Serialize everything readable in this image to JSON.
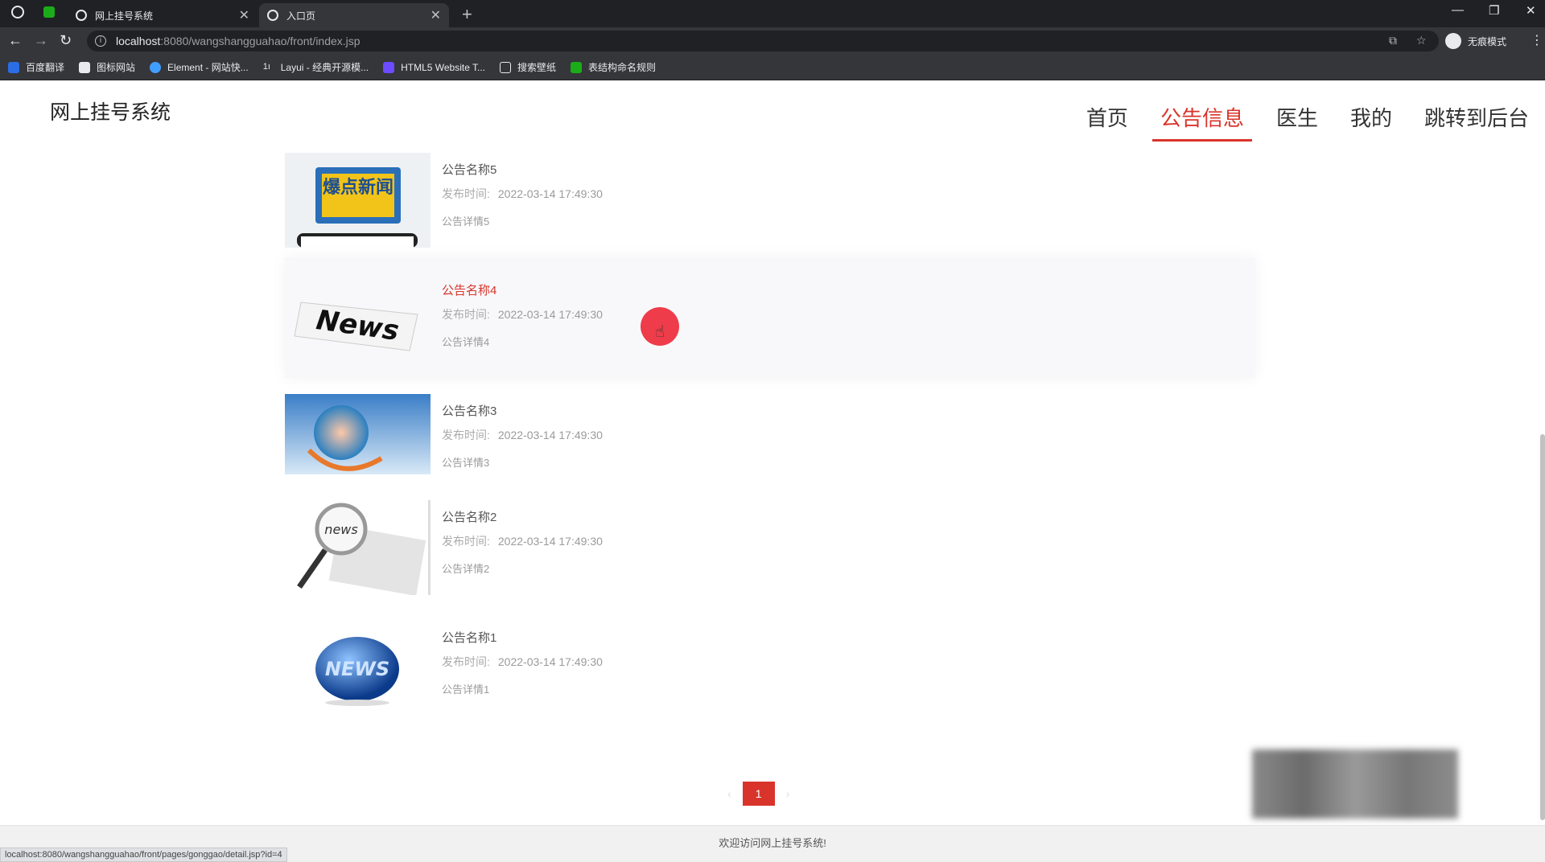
{
  "browser": {
    "tabs": [
      {
        "title": "网上挂号系统",
        "active": false
      },
      {
        "title": "入口页",
        "active": true
      }
    ],
    "new_tab": "+",
    "address": {
      "host": "localhost",
      "path": ":8080/wangshangguahao/front/index.jsp"
    },
    "profile_label": "无痕模式",
    "bookmarks": [
      {
        "label": "百度翻译",
        "color": "#2b6de5"
      },
      {
        "label": "图标网站",
        "color": "#e8eaed"
      },
      {
        "label": "Element - 网站快...",
        "color": "#409eff"
      },
      {
        "label": "Layui - 经典开源模...",
        "color": "#e8eaed"
      },
      {
        "label": "HTML5 Website T...",
        "color": "#6d4cff"
      },
      {
        "label": "搜索壁纸",
        "color": "#e8eaed"
      },
      {
        "label": "表结构命名规则",
        "color": "#1aad19"
      }
    ]
  },
  "site": {
    "title": "网上挂号系统"
  },
  "nav": {
    "items": [
      {
        "label": "首页",
        "active": false
      },
      {
        "label": "公告信息",
        "active": true
      },
      {
        "label": "医生",
        "active": false
      },
      {
        "label": "我的",
        "active": false
      },
      {
        "label": "跳转到后台",
        "active": false
      }
    ]
  },
  "news": [
    {
      "title": "公告名称5",
      "time_label": "发布时间:",
      "time": "2022-03-14 17:49:30",
      "detail": "公告详情5",
      "image": "爆点新闻",
      "hover": false
    },
    {
      "title": "公告名称4",
      "time_label": "发布时间:",
      "time": "2022-03-14 17:49:30",
      "detail": "公告详情4",
      "image": "News",
      "hover": true
    },
    {
      "title": "公告名称3",
      "time_label": "发布时间:",
      "time": "2022-03-14 17:49:30",
      "detail": "公告详情3",
      "image": "globe-blue",
      "hover": false
    },
    {
      "title": "公告名称2",
      "time_label": "发布时间:",
      "time": "2022-03-14 17:49:30",
      "detail": "公告详情2",
      "image": "news",
      "hover": false
    },
    {
      "title": "公告名称1",
      "time_label": "发布时间:",
      "time": "2022-03-14 17:49:30",
      "detail": "公告详情1",
      "image": "NEWS",
      "hover": false
    }
  ],
  "pager": {
    "prev": "‹",
    "current": "1",
    "next": "›"
  },
  "footer": {
    "text": "欢迎访问网上挂号系统!"
  },
  "status_url": "localhost:8080/wangshangguahao/front/pages/gonggao/detail.jsp?id=4",
  "colors": {
    "accent": "#d9342b"
  }
}
